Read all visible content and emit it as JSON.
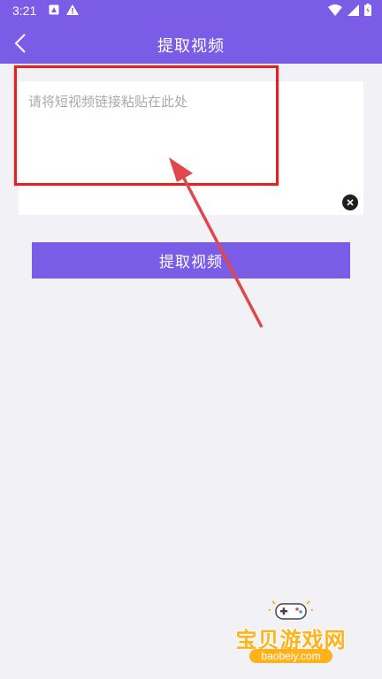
{
  "status_bar": {
    "time": "3:21"
  },
  "app_bar": {
    "title": "提取视频"
  },
  "input": {
    "placeholder": "请将短视频链接粘贴在此处",
    "value": ""
  },
  "button": {
    "label": "提取视频"
  },
  "watermark": {
    "text": "宝贝游戏网",
    "url": "baobeiy.com"
  },
  "colors": {
    "accent": "#7b5ce6",
    "background": "#f1f1f6",
    "annotation": "#e02222"
  }
}
